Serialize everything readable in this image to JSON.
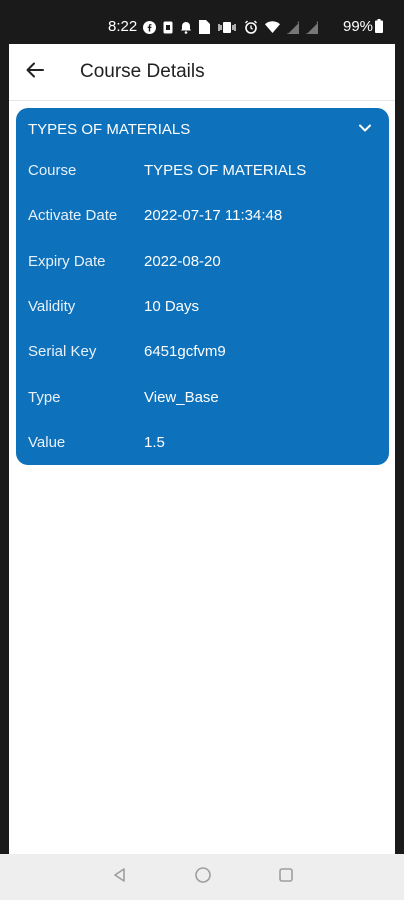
{
  "status_bar": {
    "time": "8:22",
    "battery": "99%",
    "icons": [
      "facebook-icon",
      "sim-icon",
      "notification-bell-icon",
      "document-icon",
      "vibrate-icon",
      "alarm-icon",
      "wifi-icon",
      "signal-icon",
      "signal-icon",
      "battery-icon"
    ]
  },
  "toolbar": {
    "title": "Course Details",
    "back_icon": "arrow-left-icon"
  },
  "card": {
    "title": "TYPES OF MATERIALS",
    "accent_color": "#0d71bb",
    "expand_icon": "chevron-down-icon",
    "rows": [
      {
        "label": "Course",
        "value": "TYPES OF MATERIALS"
      },
      {
        "label": "Activate Date",
        "value": "2022-07-17 11:34:48"
      },
      {
        "label": "Expiry Date",
        "value": "2022-08-20"
      },
      {
        "label": "Validity",
        "value": "10 Days"
      },
      {
        "label": "Serial Key",
        "value": "6451gcfvm9"
      },
      {
        "label": "Type",
        "value": "View_Base"
      },
      {
        "label": "Value",
        "value": "1.5"
      }
    ]
  },
  "nav_bar": {
    "icons": [
      "back-triangle-icon",
      "home-circle-icon",
      "recents-square-icon"
    ]
  }
}
